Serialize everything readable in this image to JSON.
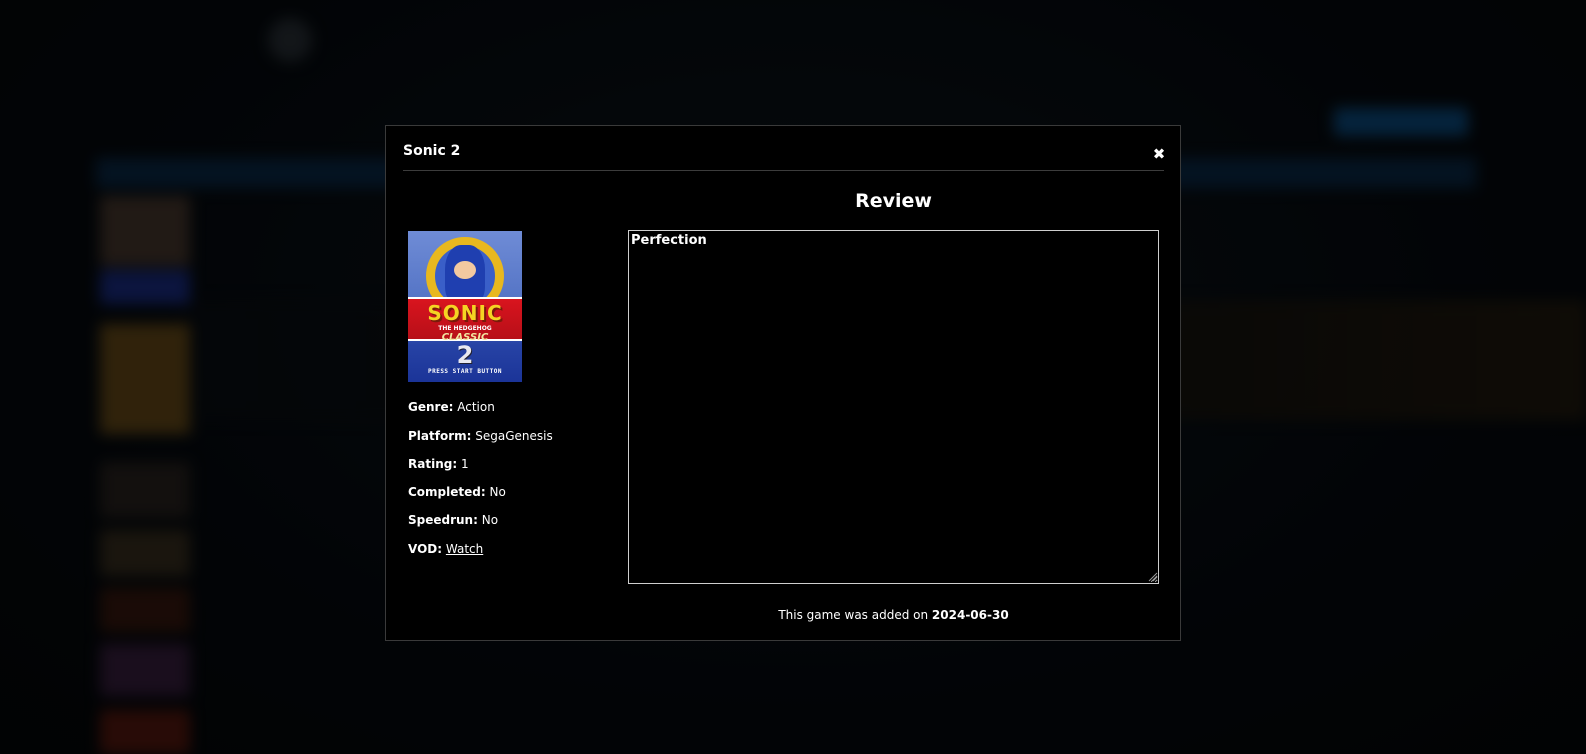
{
  "modal": {
    "title": "Sonic 2",
    "close_icon": "close-icon",
    "review_heading": "Review",
    "cover": {
      "icon": "game-cover-art",
      "title_word": "SONIC",
      "subtitle": "THE HEDGEHOG",
      "edition": "CLASSIC",
      "number": "2",
      "prompt": "PRESS START BUTTON"
    },
    "details": {
      "genre_label": "Genre:",
      "genre_value": "Action",
      "platform_label": "Platform:",
      "platform_value": "SegaGenesis",
      "rating_label": "Rating:",
      "rating_value": "1",
      "completed_label": "Completed:",
      "completed_value": "No",
      "speedrun_label": "Speedrun:",
      "speedrun_value": "No",
      "vod_label": "VOD:",
      "vod_link": "Watch"
    },
    "review_text": "Perfection",
    "added_prefix": "This game was added on",
    "added_date": "2024-06-30"
  },
  "colors": {
    "modal_background": "#000000",
    "overlay": "#05090d",
    "accent_blue": "#0d4f86"
  }
}
